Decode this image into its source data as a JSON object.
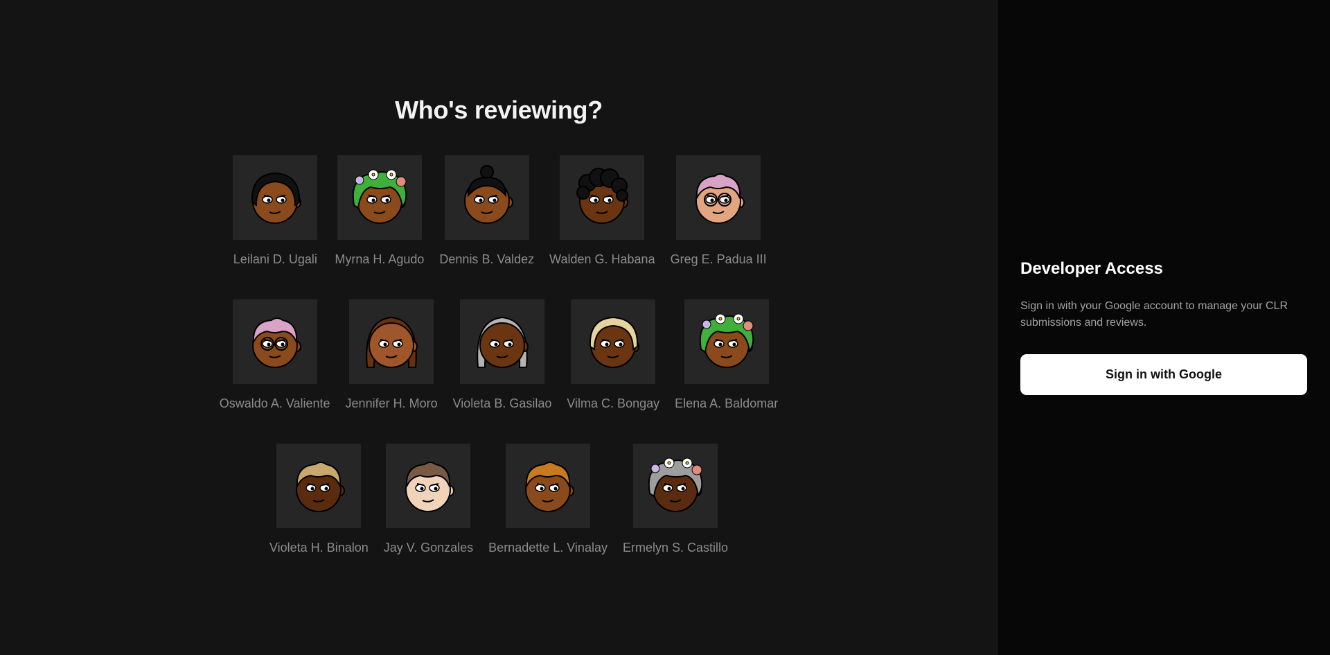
{
  "main": {
    "title": "Who's reviewing?",
    "reviewers": [
      {
        "name": "Leilani D. Ugali",
        "skin": "#8a4a1c",
        "hair": "#111111",
        "hair_style": "bob",
        "flowers": false,
        "glasses": false
      },
      {
        "name": "Myrna H. Agudo",
        "skin": "#8a4a1c",
        "hair": "#3fb03a",
        "hair_style": "wavy",
        "flowers": true,
        "glasses": false
      },
      {
        "name": "Dennis B. Valdez",
        "skin": "#8a4a1c",
        "hair": "#111111",
        "hair_style": "bun",
        "flowers": false,
        "glasses": false
      },
      {
        "name": "Walden G. Habana",
        "skin": "#6b3511",
        "hair": "#111111",
        "hair_style": "curly",
        "flowers": false,
        "glasses": false
      },
      {
        "name": "Greg E. Padua III",
        "skin": "#e2a57f",
        "hair": "#d9a3c8",
        "hair_style": "short",
        "flowers": false,
        "glasses": true
      },
      {
        "name": "Oswaldo A. Valiente",
        "skin": "#8a4a1c",
        "hair": "#d9a3c8",
        "hair_style": "short",
        "flowers": false,
        "glasses": true
      },
      {
        "name": "Jennifer H. Moro",
        "skin": "#a0562b",
        "hair": "#6b2f12",
        "hair_style": "long",
        "flowers": false,
        "glasses": false
      },
      {
        "name": "Violeta B. Gasilao",
        "skin": "#6b3511",
        "hair": "#b3b3b3",
        "hair_style": "long",
        "flowers": false,
        "glasses": false
      },
      {
        "name": "Vilma C. Bongay",
        "skin": "#6b3511",
        "hair": "#e6d3a0",
        "hair_style": "bob",
        "flowers": false,
        "glasses": false
      },
      {
        "name": "Elena A. Baldomar",
        "skin": "#8a4a1c",
        "hair": "#3fb03a",
        "hair_style": "wavy",
        "flowers": true,
        "glasses": false
      },
      {
        "name": "Violeta H. Binalon",
        "skin": "#5a2b0e",
        "hair": "#c9a96b",
        "hair_style": "short",
        "flowers": false,
        "glasses": false
      },
      {
        "name": "Jay V. Gonzales",
        "skin": "#f0d3b8",
        "hair": "#7a5a44",
        "hair_style": "short",
        "flowers": false,
        "glasses": false
      },
      {
        "name": "Bernadette L. Vinalay",
        "skin": "#8a4a1c",
        "hair": "#c97a1e",
        "hair_style": "short",
        "flowers": false,
        "glasses": false
      },
      {
        "name": "Ermelyn S. Castillo",
        "skin": "#5a2b0e",
        "hair": "#9e9e9e",
        "hair_style": "wavy",
        "flowers": true,
        "glasses": false
      }
    ]
  },
  "side": {
    "heading": "Developer Access",
    "description": "Sign in with your Google account to manage your CLR submissions and reviews.",
    "button_label": "Sign in with Google"
  },
  "colors": {
    "main_bg": "#141414",
    "side_bg": "#070707",
    "tile_bg": "#262626",
    "name_text": "#8c8c8c",
    "button_bg": "#ffffff"
  }
}
